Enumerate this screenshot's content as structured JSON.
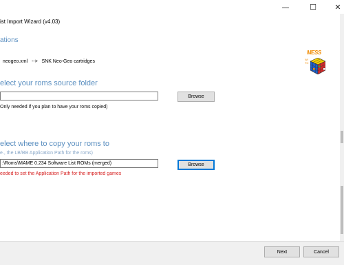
{
  "window": {
    "title": "ist Import Wizard  (v4.03)",
    "minimize_glyph": "—",
    "maximize_glyph": "☐",
    "close_glyph": "✕"
  },
  "section": {
    "title": "ations"
  },
  "mapping": {
    "file": "neogeo.xml",
    "arrow": "-->",
    "target": "SNK Neo-Geo cartridges"
  },
  "logo": {
    "text_top": "MESS",
    "text_side": "WITH"
  },
  "source": {
    "heading": "elect your roms source folder",
    "input_value": "",
    "browse_label": "Browse",
    "note": "Only needed if you plan to have your roms copied)"
  },
  "dest": {
    "heading": "elect where to copy your roms to",
    "hint": "e., the LB/BB Application Path for the roms)",
    "input_value": ":\\Roms\\MAME 0.234 Software List ROMs (merged)",
    "browse_label": "Browse",
    "warning": "eeded to set the Application Path for the imported games"
  },
  "footer": {
    "next_label": "Next",
    "cancel_label": "Cancel"
  },
  "colors": {
    "heading": "#5b8fc0",
    "warning": "#d62020",
    "focus": "#0078d7"
  }
}
